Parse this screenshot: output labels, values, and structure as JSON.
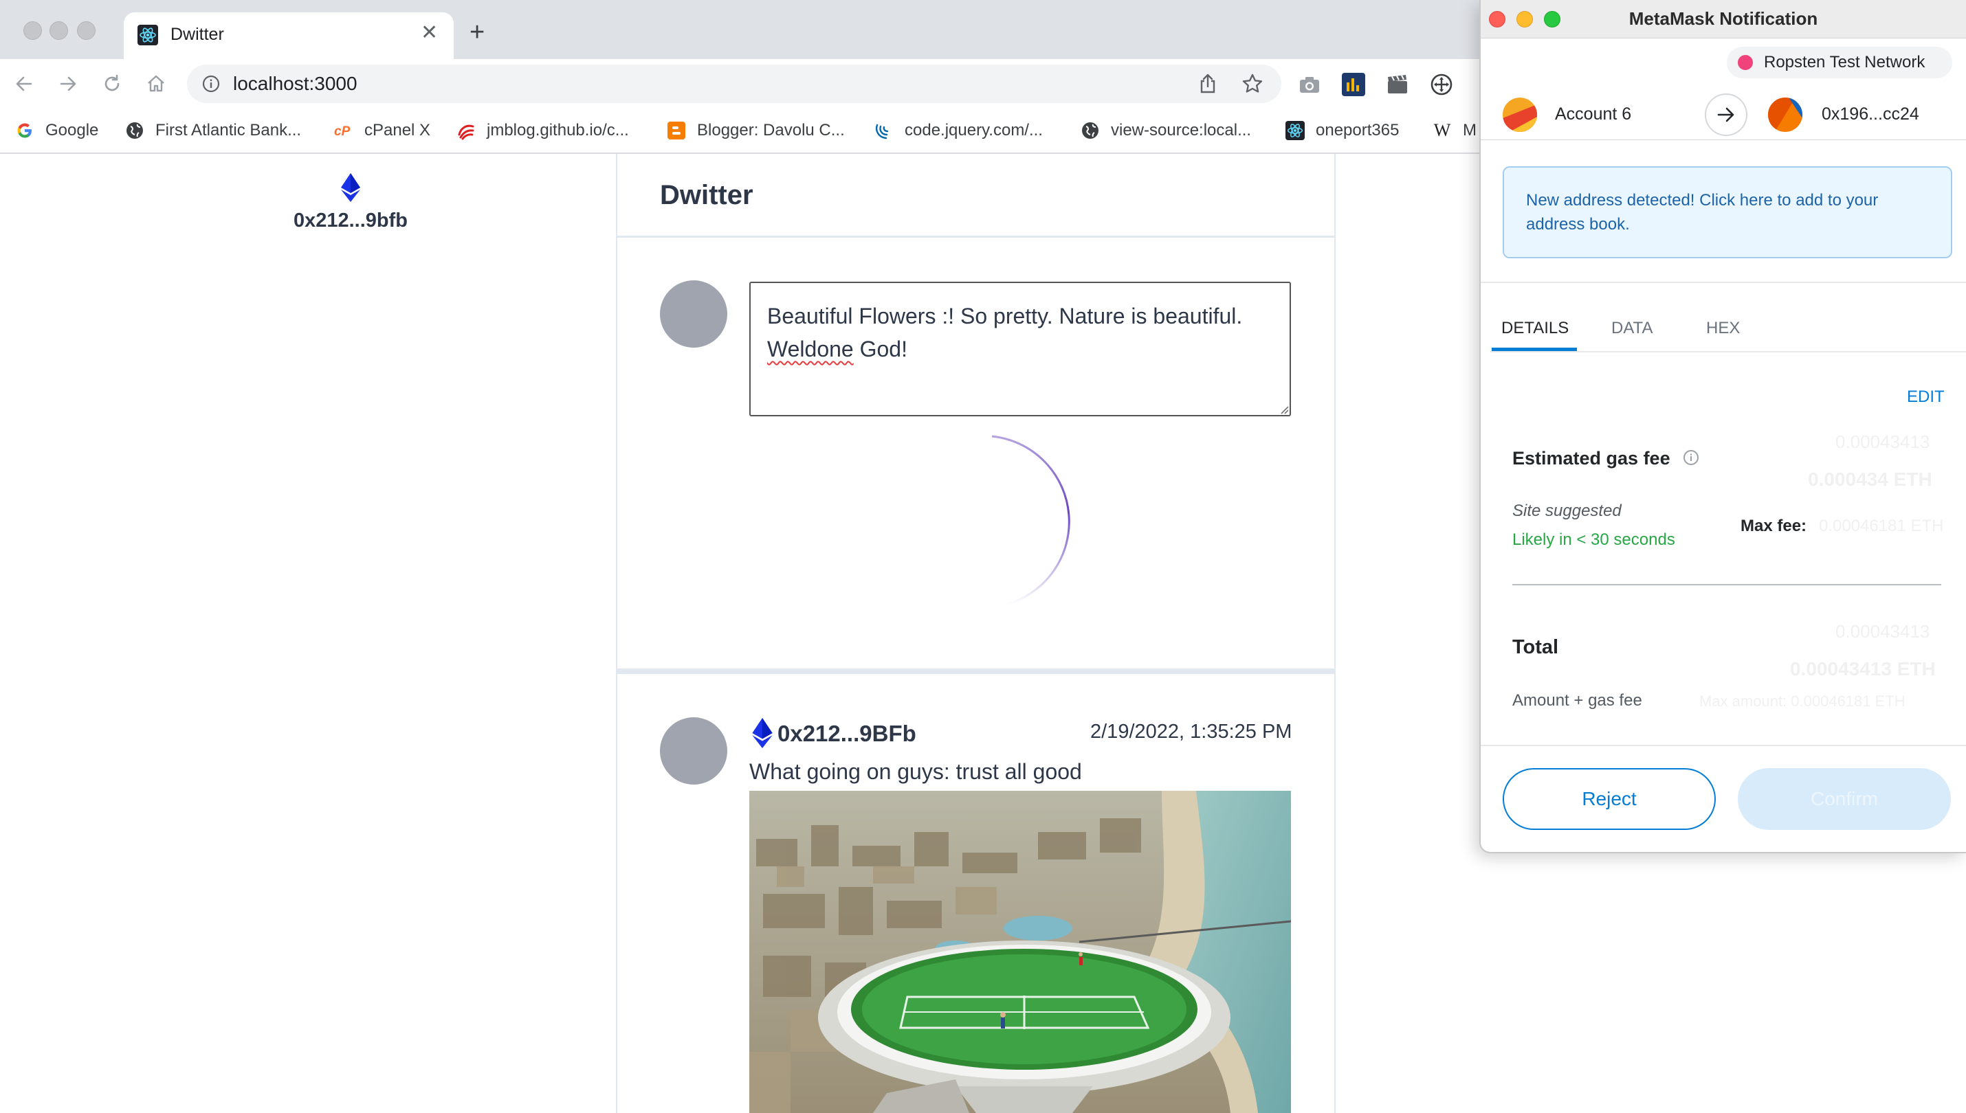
{
  "browser": {
    "tab_title": "Dwitter",
    "url": "localhost:3000",
    "bookmarks": [
      {
        "label": "Google",
        "icon": "google-icon"
      },
      {
        "label": "First Atlantic Bank...",
        "icon": "globe-icon"
      },
      {
        "label": "cPanel X",
        "icon": "cpanel-icon"
      },
      {
        "label": "jmblog.github.io/c...",
        "icon": "swirl-icon"
      },
      {
        "label": "Blogger: Davolu C...",
        "icon": "blogger-icon"
      },
      {
        "label": "code.jquery.com/...",
        "icon": "jquery-icon"
      },
      {
        "label": "view-source:local...",
        "icon": "globe-icon"
      },
      {
        "label": "oneport365",
        "icon": "react-icon"
      },
      {
        "label": "M",
        "icon": "wikipedia-icon"
      }
    ]
  },
  "app": {
    "account_address": "0x212...9bfb",
    "title": "Dwitter",
    "compose": {
      "line1": "Beautiful Flowers :! So pretty. Nature is beautiful.",
      "line2_word": "Weldone",
      "line2_rest": " God!"
    },
    "post": {
      "author": "0x212...9BFb",
      "timestamp": "2/19/2022, 1:35:25 PM",
      "text": "What going on guys: trust all good"
    }
  },
  "metamask": {
    "window_title": "MetaMask Notification",
    "network": "Ropsten Test Network",
    "from_account": "Account 6",
    "to_account": "0x196...cc24",
    "notice": "New address detected! Click here to add to your address book.",
    "tabs": [
      "DETAILS",
      "DATA",
      "HEX"
    ],
    "edit_label": "EDIT",
    "gas_fee_title": "Estimated gas fee",
    "site_suggested": "Site suggested",
    "likely": "Likely in < 30 seconds",
    "max_fee_label": "Max fee:",
    "ghost_gas_1": "0.00043413",
    "ghost_gas_2": "0.000434 ETH",
    "ghost_maxfee": "0.00046181 ETH",
    "total_title": "Total",
    "amount_gas": "Amount + gas fee",
    "ghost_total_1": "0.00043413",
    "ghost_total_2": "0.00043413 ETH",
    "ghost_max_amount": "Max amount: 0.00046181 ETH",
    "reject_label": "Reject",
    "confirm_label": "Confirm",
    "colors": {
      "accent": "#037dd6",
      "success": "#28a745",
      "network_dot": "#f0437c"
    }
  }
}
